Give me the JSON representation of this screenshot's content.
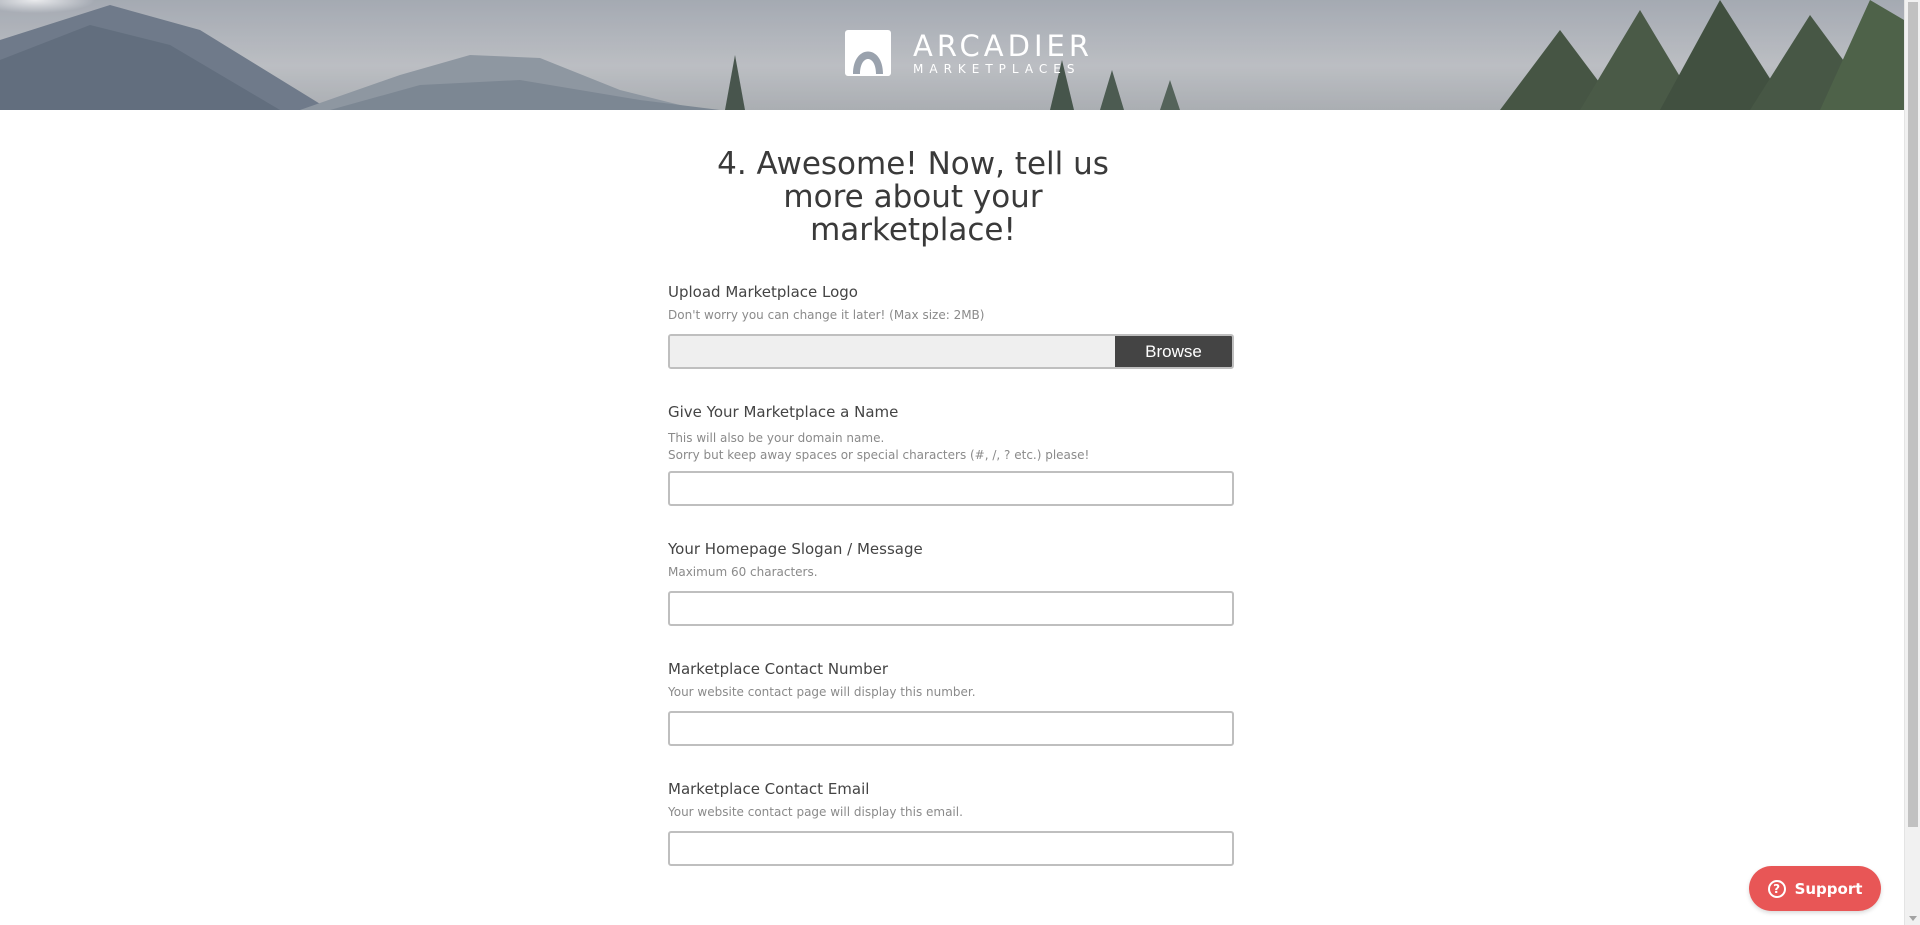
{
  "brand": {
    "name": "ARCADIER",
    "subtitle": "MARKETPLACES"
  },
  "page": {
    "heading": "4. Awesome! Now, tell us more about your marketplace!"
  },
  "fields": {
    "logo": {
      "label": "Upload Marketplace Logo",
      "help": "Don't worry you can change it later! (Max size: 2MB)",
      "button_label": "Browse",
      "value": ""
    },
    "name": {
      "label": "Give Your Marketplace a Name",
      "help_line1": "This will also be your domain name.",
      "help_line2": "Sorry but keep away spaces or special characters (#, /, ? etc.) please!",
      "value": ""
    },
    "slogan": {
      "label": "Your Homepage Slogan / Message",
      "help": "Maximum 60 characters.",
      "value": ""
    },
    "contact_number": {
      "label": "Marketplace Contact Number",
      "help": "Your website contact page will display this number.",
      "value": ""
    },
    "contact_email": {
      "label": "Marketplace Contact Email",
      "help": "Your website contact page will display this email.",
      "value": ""
    }
  },
  "support": {
    "label": "Support",
    "icon": "question-circle-icon"
  },
  "colors": {
    "support_button": "#e85656",
    "browse_button": "#444444"
  }
}
